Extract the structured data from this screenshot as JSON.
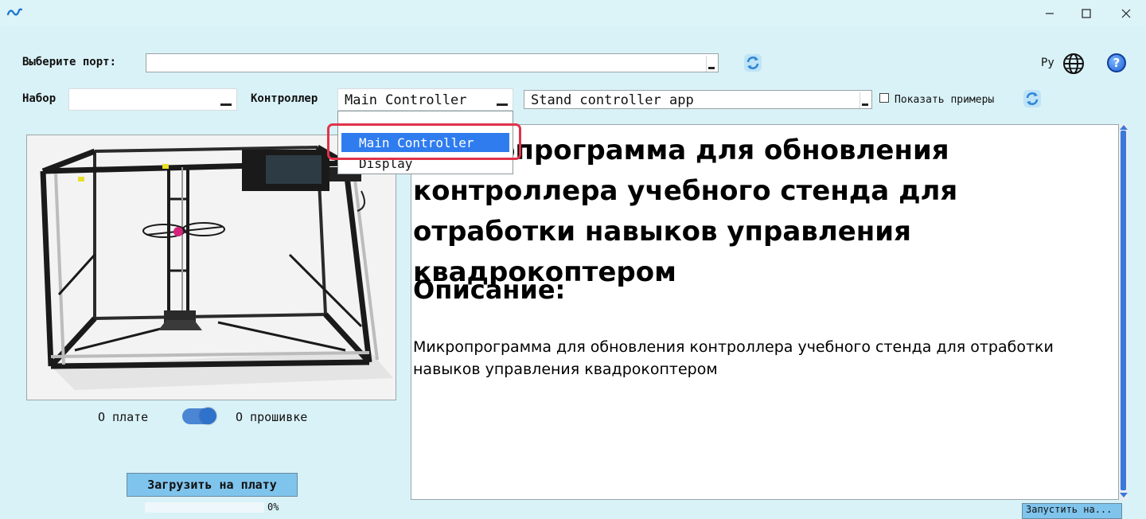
{
  "window": {
    "logo_icon": "app-logo-icon",
    "minimize_icon": "minimize-icon",
    "maximize_icon": "maximize-icon",
    "close_icon": "close-icon"
  },
  "port": {
    "label": "Выберите порт:",
    "value": ""
  },
  "language": {
    "label": "Ру",
    "icon": "globe-icon"
  },
  "help_icon": "?",
  "kit": {
    "label": "Набор",
    "value": ""
  },
  "controller": {
    "label": "Контроллер",
    "value": "Main Controller",
    "options": [
      "Main Controller",
      "Display"
    ],
    "selected_index": 0
  },
  "firmware": {
    "value": "Stand controller app"
  },
  "examples": {
    "label": "Показать примеры",
    "checked": false
  },
  "toggle": {
    "left_label": "О плате",
    "right_label": "О прошивке",
    "state": "right"
  },
  "upload": {
    "label": "Загрузить на плату",
    "progress_text": "0%",
    "progress": 0
  },
  "description": {
    "title": "Микропрограмма для обновления контроллера учебного стенда для отработки навыков управления квадрокоптером",
    "subtitle": "Описание:",
    "body": "Микропрограмма для обновления контроллера учебного стенда для отработки навыков управления квадрокоптером"
  },
  "run_button": {
    "label": "Запустить на..."
  },
  "colors": {
    "background": "#d9f2f7",
    "accent": "#2f7cef",
    "highlight_frame": "#e0334a",
    "button": "#7fc4ec"
  }
}
